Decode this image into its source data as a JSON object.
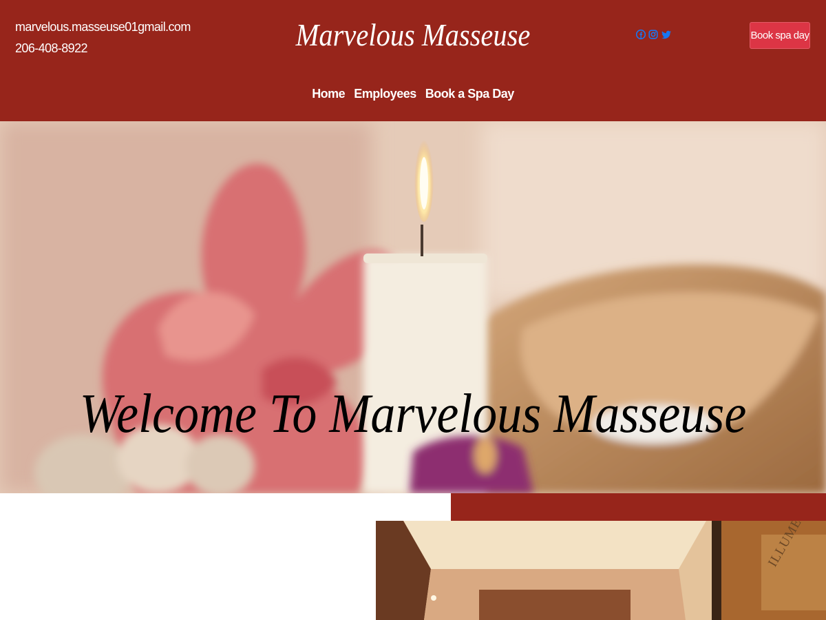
{
  "header": {
    "email": "marvelous.masseuse01gmail.com",
    "phone": "206-408-8922",
    "brand": "Marvelous Masseuse",
    "book_button": "Book spa day",
    "social_icons": [
      "facebook-icon",
      "instagram-icon",
      "twitter-icon"
    ],
    "icon_color": "#1877f2",
    "background": "#97251b",
    "button_color": "#dc3545"
  },
  "nav": {
    "items": [
      {
        "label": "Home"
      },
      {
        "label": "Employees"
      },
      {
        "label": "Book a Spa Day"
      }
    ]
  },
  "hero": {
    "title": "Welcome To Marvelous Masseuse"
  },
  "room_image": {
    "sign_text": "ILLUME"
  }
}
